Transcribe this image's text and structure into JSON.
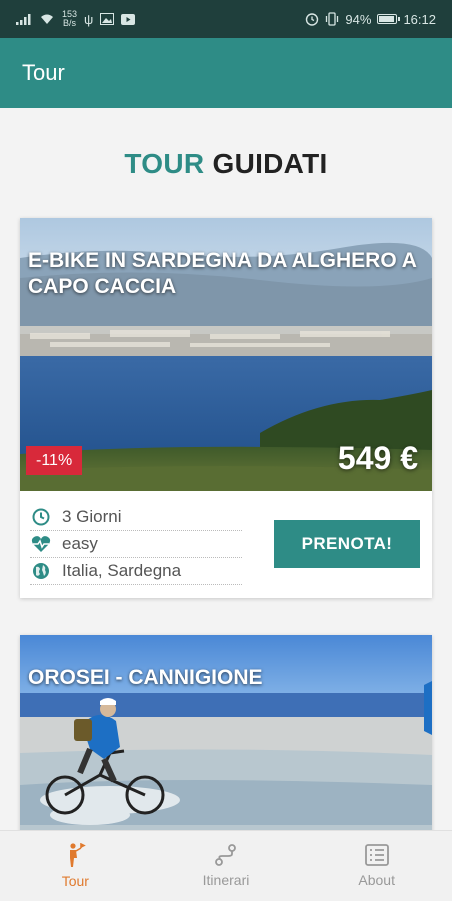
{
  "status": {
    "speed_top": "153",
    "speed_bottom": "B/s",
    "battery": "94%",
    "time": "16:12",
    "icons": [
      "signal-icon",
      "wifi-icon",
      "usb-icon",
      "image-icon",
      "youtube-icon",
      "alarm-icon",
      "vibrate-icon",
      "battery-icon"
    ]
  },
  "appbar": {
    "title": "Tour"
  },
  "page": {
    "title_accent": "TOUR",
    "title_rest": "GUIDATI"
  },
  "tours": [
    {
      "title": "E-bike in Sardegna da Alghero a Capo Caccia",
      "discount": "-11%",
      "price": "549 €",
      "duration": "3 Giorni",
      "difficulty": "easy",
      "location": "Italia, Sardegna",
      "cta": "PRENOTA!"
    },
    {
      "title": "Orosei - Cannigione"
    }
  ],
  "tabs": [
    {
      "label": "Tour",
      "icon": "hiker-icon",
      "active": true
    },
    {
      "label": "Itinerari",
      "icon": "route-icon",
      "active": false
    },
    {
      "label": "About",
      "icon": "list-icon",
      "active": false
    }
  ],
  "colors": {
    "brand": "#2e8c86",
    "status_bar": "#1f3f3c",
    "discount": "#d8293a",
    "active_tab": "#e07a2e"
  }
}
